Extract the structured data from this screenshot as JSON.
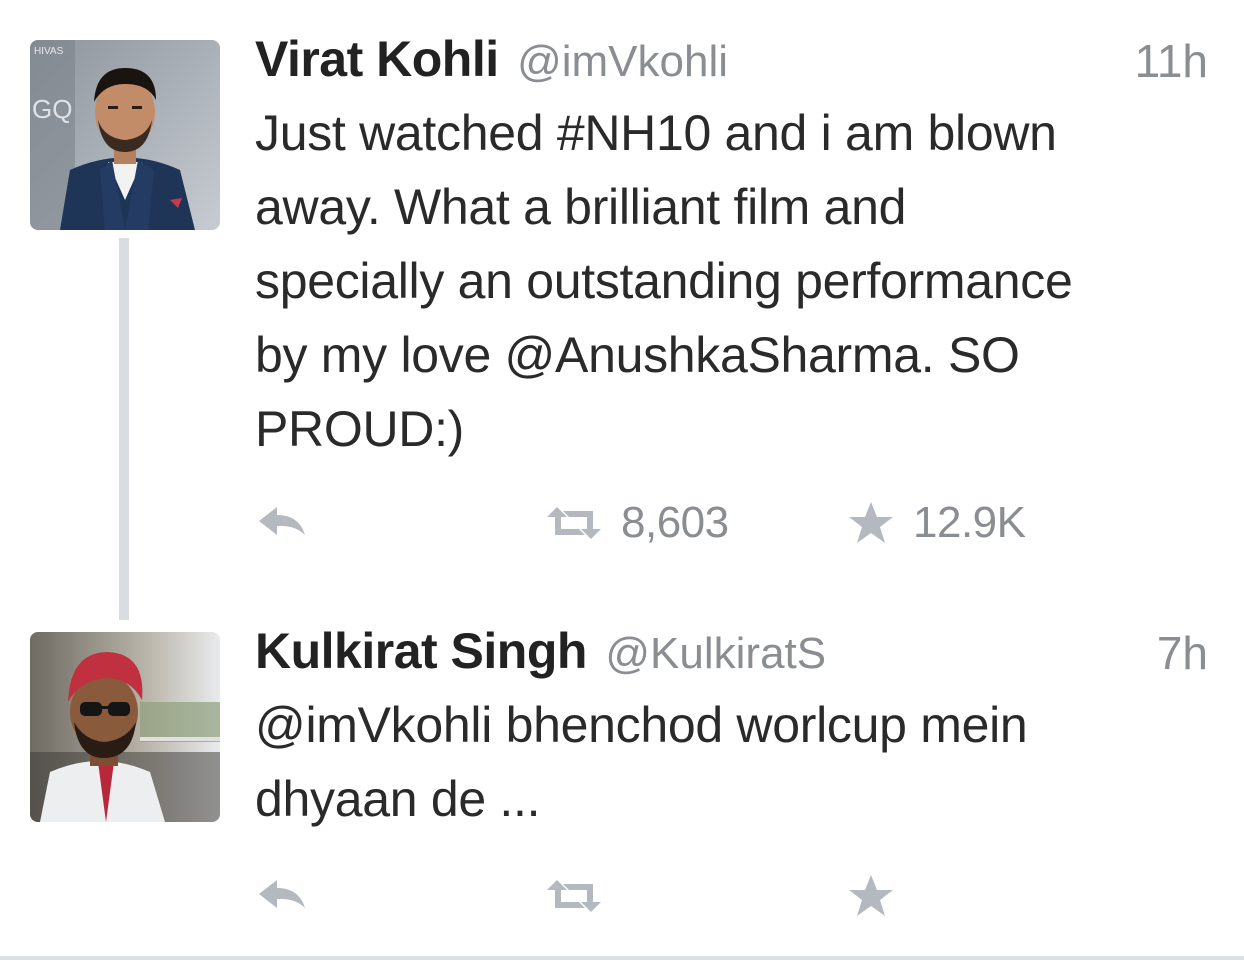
{
  "tweets": [
    {
      "name": "Virat Kohli",
      "handle": "@imVkohli",
      "time": "11h",
      "text_lines": [
        "Just watched #NH10 and i am blown",
        "away. What a brilliant film and",
        "specially an outstanding performance",
        "by my love @AnushkaSharma. SO",
        "PROUD:)"
      ],
      "retweet_count": "8,603",
      "favorite_count": "12.9K"
    },
    {
      "name": "Kulkirat Singh",
      "handle": "@KulkiratS",
      "time": "7h",
      "text_lines": [
        "@imVkohli bhenchod worlcup mein",
        "dhyaan de ..."
      ],
      "retweet_count": "",
      "favorite_count": ""
    }
  ],
  "icons": {
    "reply": "reply-icon",
    "retweet": "retweet-icon",
    "favorite": "star-icon"
  },
  "colors": {
    "icon_gray": "#b4b9bf",
    "meta_gray": "#8a8d91",
    "text": "#2a2a2a",
    "thread_line": "#d9dde3"
  }
}
